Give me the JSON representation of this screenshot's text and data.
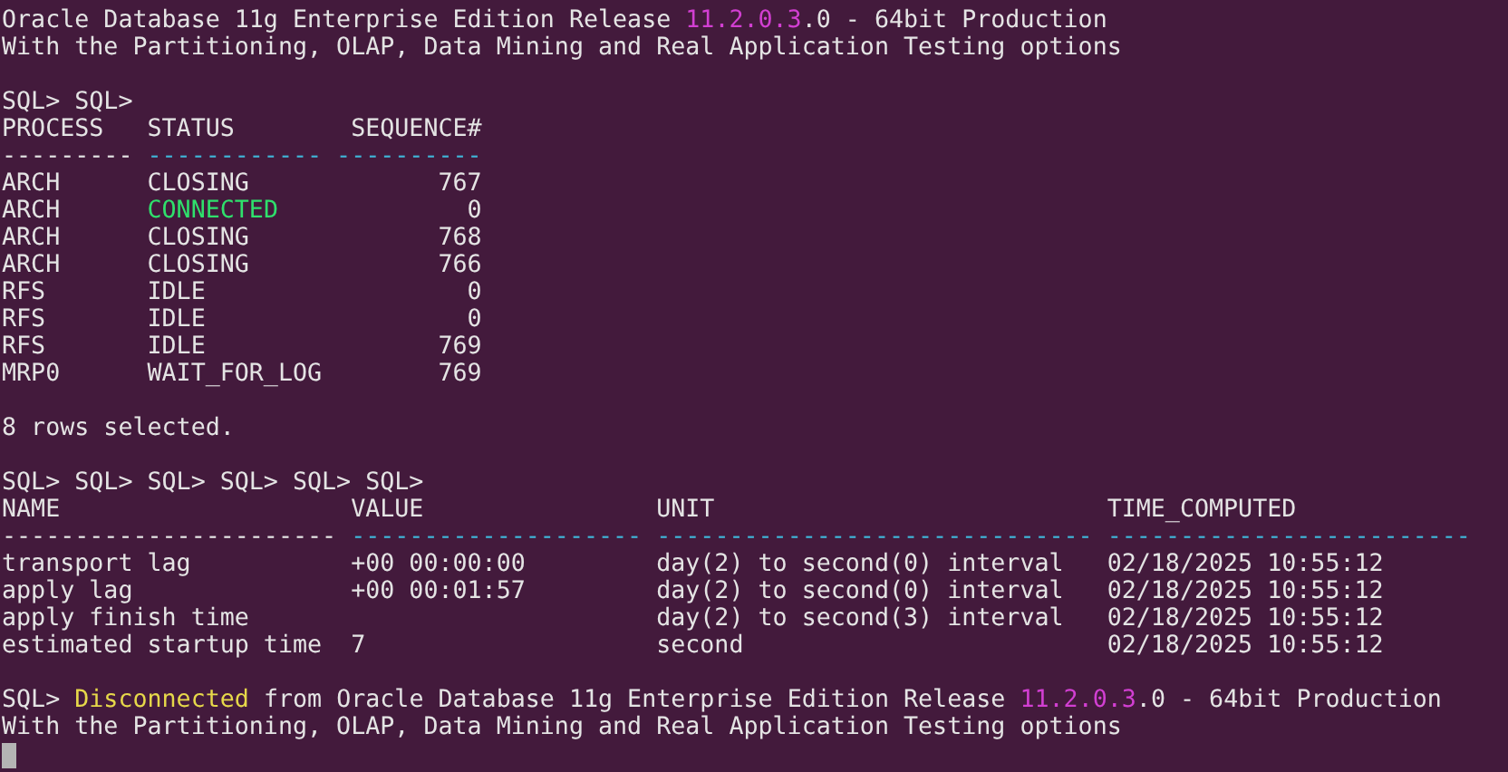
{
  "terminal": {
    "lines": [
      {
        "kind": "text",
        "segments": [
          {
            "text": "Oracle Database 11g Enterprise Edition Release "
          },
          {
            "text": "11.2.0.3",
            "color": "#d23fd2"
          },
          {
            "text": ".0 - 64bit Production"
          }
        ]
      },
      {
        "kind": "text",
        "segments": [
          {
            "text": "With the Partitioning, OLAP, Data Mining and Real Application Testing options"
          }
        ]
      },
      {
        "kind": "blank"
      },
      {
        "kind": "text",
        "segments": [
          {
            "text": "SQL> SQL>"
          }
        ]
      },
      {
        "kind": "text",
        "segments": [
          {
            "text": "PROCESS   STATUS        SEQUENCE#"
          }
        ]
      },
      {
        "kind": "text",
        "segments": [
          {
            "text": "---------"
          },
          {
            "text": " ------------ ----------",
            "color": "#3fb6d8"
          }
        ]
      },
      {
        "kind": "text",
        "segments": [
          {
            "text": "ARCH      CLOSING             767"
          }
        ]
      },
      {
        "kind": "text",
        "segments": [
          {
            "text": "ARCH      "
          },
          {
            "text": "CONNECTED",
            "color": "#2fe06c"
          },
          {
            "text": "             0"
          }
        ]
      },
      {
        "kind": "text",
        "segments": [
          {
            "text": "ARCH      CLOSING             768"
          }
        ]
      },
      {
        "kind": "text",
        "segments": [
          {
            "text": "ARCH      CLOSING             766"
          }
        ]
      },
      {
        "kind": "text",
        "segments": [
          {
            "text": "RFS       IDLE                  0"
          }
        ]
      },
      {
        "kind": "text",
        "segments": [
          {
            "text": "RFS       IDLE                  0"
          }
        ]
      },
      {
        "kind": "text",
        "segments": [
          {
            "text": "RFS       IDLE                769"
          }
        ]
      },
      {
        "kind": "text",
        "segments": [
          {
            "text": "MRP0      WAIT_FOR_LOG        769"
          }
        ]
      },
      {
        "kind": "blank"
      },
      {
        "kind": "text",
        "segments": [
          {
            "text": "8 rows selected."
          }
        ]
      },
      {
        "kind": "blank"
      },
      {
        "kind": "text",
        "segments": [
          {
            "text": "SQL> SQL> SQL> SQL> SQL> SQL>"
          }
        ]
      },
      {
        "kind": "text",
        "segments": [
          {
            "text": "NAME                    VALUE                UNIT                           TIME_COMPUTED"
          }
        ]
      },
      {
        "kind": "text",
        "segments": [
          {
            "text": "-----------------------"
          },
          {
            "text": " -------------------- ------------------------------ -------------------------",
            "color": "#3fb6d8"
          }
        ]
      },
      {
        "kind": "text",
        "segments": [
          {
            "text": "transport lag           +00 00:00:00         day(2) to second(0) interval   02/18/2025 10:55:12"
          }
        ]
      },
      {
        "kind": "text",
        "segments": [
          {
            "text": "apply lag               +00 00:01:57         day(2) to second(0) interval   02/18/2025 10:55:12"
          }
        ]
      },
      {
        "kind": "text",
        "segments": [
          {
            "text": "apply finish time                            day(2) to second(3) interval   02/18/2025 10:55:12"
          }
        ]
      },
      {
        "kind": "text",
        "segments": [
          {
            "text": "estimated startup time  7                    second                         02/18/2025 10:55:12"
          }
        ]
      },
      {
        "kind": "blank"
      },
      {
        "kind": "text",
        "segments": [
          {
            "text": "SQL> "
          },
          {
            "text": "Disconnected",
            "color": "#e6d84a"
          },
          {
            "text": " from Oracle Database 11g Enterprise Edition Release "
          },
          {
            "text": "11.2.0.3",
            "color": "#d23fd2"
          },
          {
            "text": ".0 - 64bit Production"
          }
        ]
      },
      {
        "kind": "text",
        "segments": [
          {
            "text": "With the Partitioning, OLAP, Data Mining and Real Application Testing options"
          }
        ]
      },
      {
        "kind": "cursor"
      }
    ]
  }
}
